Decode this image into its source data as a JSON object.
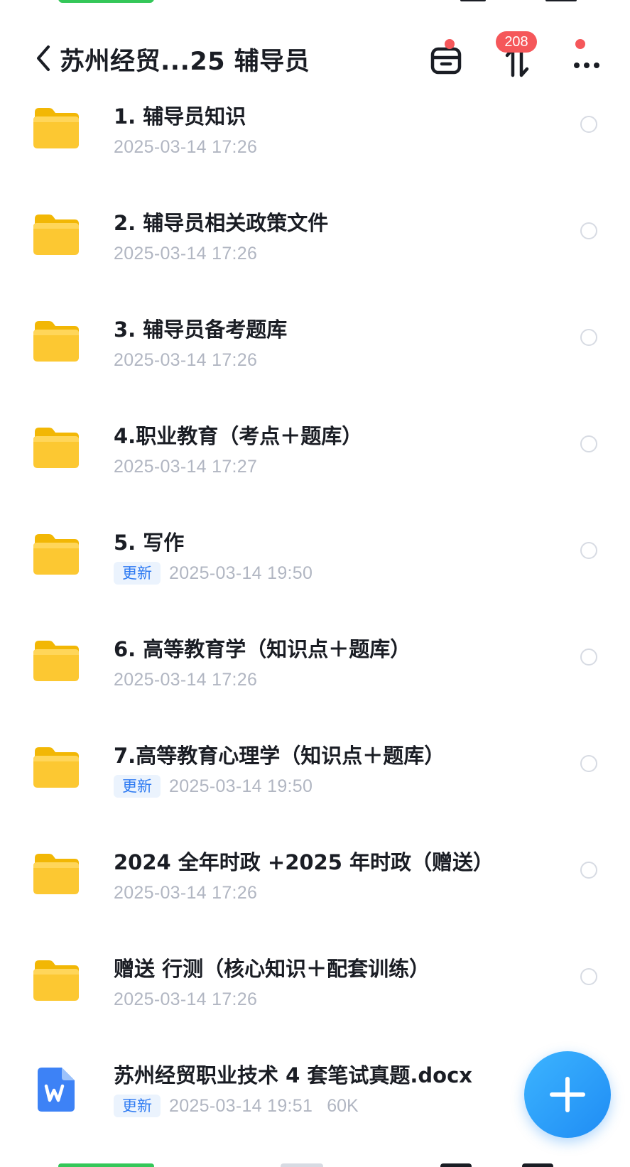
{
  "header": {
    "title": "苏州经贸...25 辅导员",
    "sort_badge_count": "208"
  },
  "files": [
    {
      "kind": "folder",
      "name": "1. 辅导员知识",
      "updated": "",
      "date": "2025-03-14 17:26",
      "size": ""
    },
    {
      "kind": "folder",
      "name": "2. 辅导员相关政策文件",
      "updated": "",
      "date": "2025-03-14 17:26",
      "size": ""
    },
    {
      "kind": "folder",
      "name": "3. 辅导员备考题库",
      "updated": "",
      "date": "2025-03-14 17:26",
      "size": ""
    },
    {
      "kind": "folder",
      "name": "4.职业教育（考点＋题库）",
      "updated": "",
      "date": "2025-03-14 17:27",
      "size": ""
    },
    {
      "kind": "folder",
      "name": "5. 写作",
      "updated": "更新",
      "date": "2025-03-14 19:50",
      "size": ""
    },
    {
      "kind": "folder",
      "name": "6. 高等教育学（知识点＋题库）",
      "updated": "",
      "date": "2025-03-14 17:26",
      "size": ""
    },
    {
      "kind": "folder",
      "name": "7.高等教育心理学（知识点＋题库）",
      "updated": "更新",
      "date": "2025-03-14 19:50",
      "size": ""
    },
    {
      "kind": "folder",
      "name": "2024 全年时政 +2025 年时政（赠送）",
      "updated": "",
      "date": "2025-03-14 17:26",
      "size": ""
    },
    {
      "kind": "folder",
      "name": "赠送 行测（核心知识＋配套训练）",
      "updated": "",
      "date": "2025-03-14 17:26",
      "size": ""
    },
    {
      "kind": "doc",
      "name": "苏州经贸职业技术 4 套笔试真题.docx",
      "updated": "更新",
      "date": "2025-03-14 19:51",
      "size": "60K"
    }
  ],
  "icons": {
    "back": "chevron-left-icon",
    "archive": "archive-box-icon",
    "sort": "sort-arrows-icon",
    "more": "more-dots-icon",
    "folder": "folder-icon",
    "word": "word-document-icon",
    "add": "plus-icon"
  },
  "colors": {
    "accent": "#1f8cf4",
    "badge_red": "#f5575a",
    "folder_yellow": "#fcc419",
    "word_blue": "#3d82f6",
    "meta_gray": "#b1b6c2"
  }
}
